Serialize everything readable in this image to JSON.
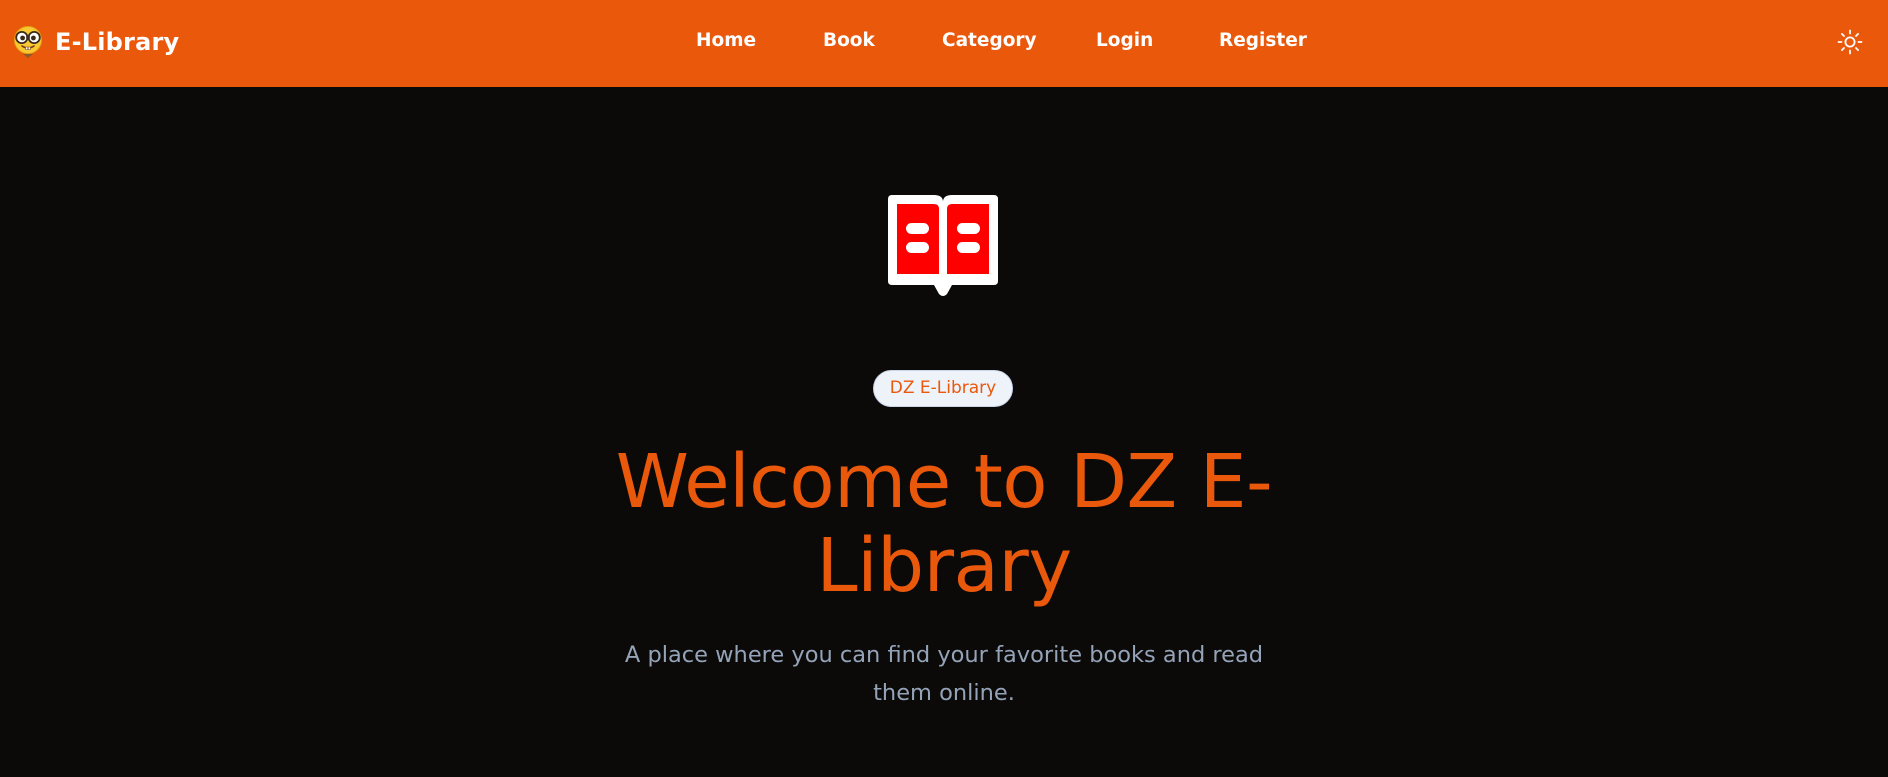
{
  "header": {
    "brand": {
      "name": "E-Library",
      "logo_icon": "nerd-face-emoji-icon"
    },
    "nav": [
      {
        "id": "home",
        "label": "Home"
      },
      {
        "id": "book",
        "label": "Book"
      },
      {
        "id": "category",
        "label": "Category"
      },
      {
        "id": "login",
        "label": "Login"
      },
      {
        "id": "register",
        "label": "Register"
      }
    ],
    "theme_toggle_icon": "sun-icon"
  },
  "hero": {
    "icon": "open-book-icon",
    "badge": "DZ E-Library",
    "title": "Welcome to DZ E-Library",
    "subtitle": "A place where you can find your favorite books and read them online."
  },
  "colors": {
    "accent": "#ea580c",
    "background": "#0b0a09",
    "subtitle": "#94a3b8",
    "badge_bg": "#eef2f9",
    "book_red": "#ff0000"
  }
}
